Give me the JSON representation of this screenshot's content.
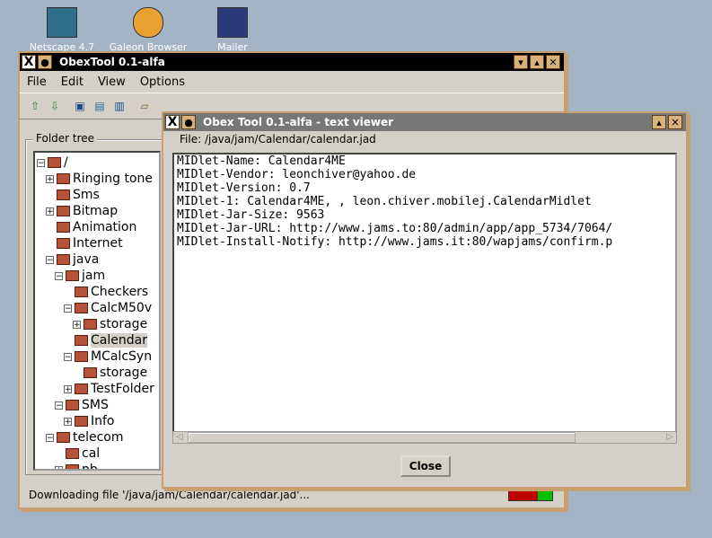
{
  "desktop": {
    "icons": [
      {
        "label": "Netscape 4.7",
        "icon": "netscape-icon"
      },
      {
        "label": "Galeon Browser",
        "icon": "galeon-icon"
      },
      {
        "label": "Mailer",
        "icon": "mailer-icon"
      }
    ]
  },
  "main_window": {
    "title": "ObexTool 0.1-alfa",
    "menu": [
      "File",
      "Edit",
      "View",
      "Options"
    ],
    "folder_tree_label": "Folder tree",
    "tree": [
      {
        "label": "/"
      },
      {
        "label": "Ringing tone"
      },
      {
        "label": "Sms"
      },
      {
        "label": "Bitmap"
      },
      {
        "label": "Animation"
      },
      {
        "label": "Internet"
      },
      {
        "label": "java"
      },
      {
        "label": "jam"
      },
      {
        "label": "Checkers"
      },
      {
        "label": "CalcM50v"
      },
      {
        "label": "storage"
      },
      {
        "label": "Calendar"
      },
      {
        "label": "MCalcSyn"
      },
      {
        "label": "storage"
      },
      {
        "label": "TestFolder"
      },
      {
        "label": "SMS"
      },
      {
        "label": "Info"
      },
      {
        "label": "telecom"
      },
      {
        "label": "cal"
      },
      {
        "label": "pb"
      }
    ],
    "status_text": "Downloading file '/java/jam/Calendar/calendar.jad'..."
  },
  "viewer": {
    "title": "Obex Tool 0.1-alfa - text viewer",
    "file_label": "File: /java/jam/Calendar/calendar.jad",
    "lines": [
      "MIDlet-Name: Calendar4ME",
      "MIDlet-Vendor: leonchiver@yahoo.de",
      "MIDlet-Version: 0.7",
      "MIDlet-1: Calendar4ME, , leon.chiver.mobilej.CalendarMidlet",
      "MIDlet-Jar-Size: 9563",
      "MIDlet-Jar-URL: http://www.jams.to:80/admin/app/app_5734/7064/",
      "MIDlet-Install-Notify: http://www.jams.it:80/wapjams/confirm.p"
    ],
    "close_label": "Close"
  }
}
